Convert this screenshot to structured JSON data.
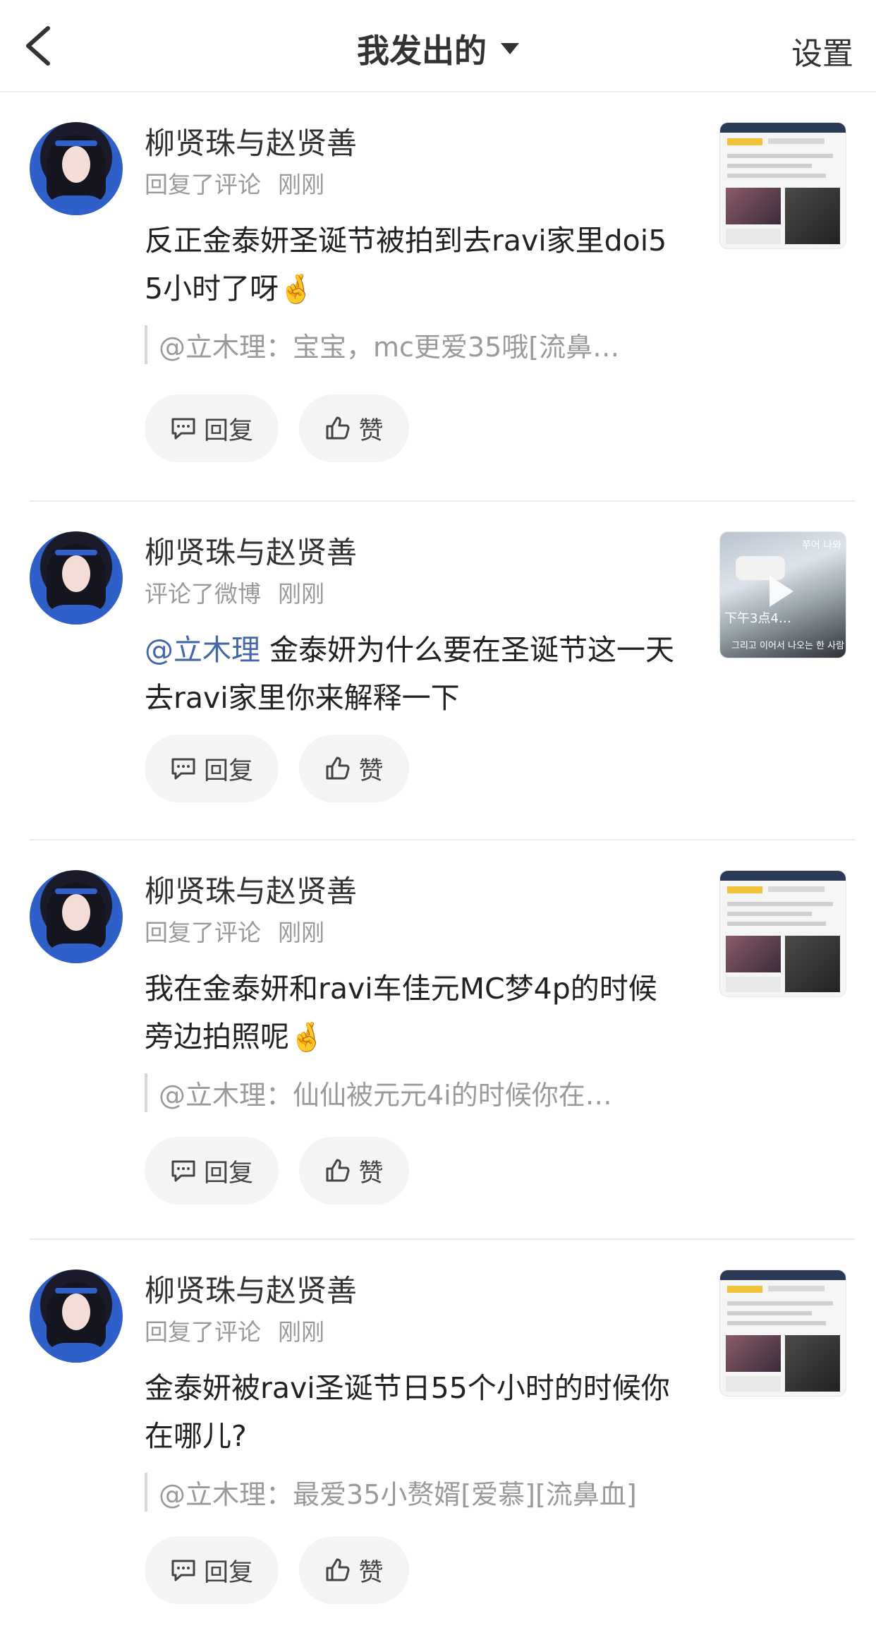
{
  "header": {
    "title": "我发出的",
    "settings_label": "设置"
  },
  "items": [
    {
      "username": "柳贤珠与赵贤善",
      "action": "回复了评论",
      "time": "刚刚",
      "content": "反正金泰妍圣诞节被拍到去ravi家里doi55小时了呀",
      "emoji": "🤞",
      "quote": "@立木理：宝宝，mc更爱35哦[流鼻…",
      "reply_label": "回复",
      "like_label": "赞"
    },
    {
      "username": "柳贤珠与赵贤善",
      "action": "评论了微博",
      "time": "刚刚",
      "mention": "@立木理",
      "content": " 金泰妍为什么要在圣诞节这一天去ravi家里你来解释一下",
      "thumb_caption1": "下午3点4…",
      "thumb_caption2": "그리고 이어서 나오는 한 사람",
      "thumb_tag": "쭈어 나와",
      "reply_label": "回复",
      "like_label": "赞"
    },
    {
      "username": "柳贤珠与赵贤善",
      "action": "回复了评论",
      "time": "刚刚",
      "content": "我在金泰妍和ravi车佳元MC梦4p的时候旁边拍照呢",
      "emoji": "🤞",
      "quote": "@立木理：仙仙被元元4i的时候你在…",
      "reply_label": "回复",
      "like_label": "赞"
    },
    {
      "username": "柳贤珠与赵贤善",
      "action": "回复了评论",
      "time": "刚刚",
      "content": "金泰妍被ravi圣诞节日55个小时的时候你在哪儿?",
      "quote": "@立木理：最爱35小赘婿[爱慕][流鼻血]",
      "reply_label": "回复",
      "like_label": "赞"
    }
  ]
}
